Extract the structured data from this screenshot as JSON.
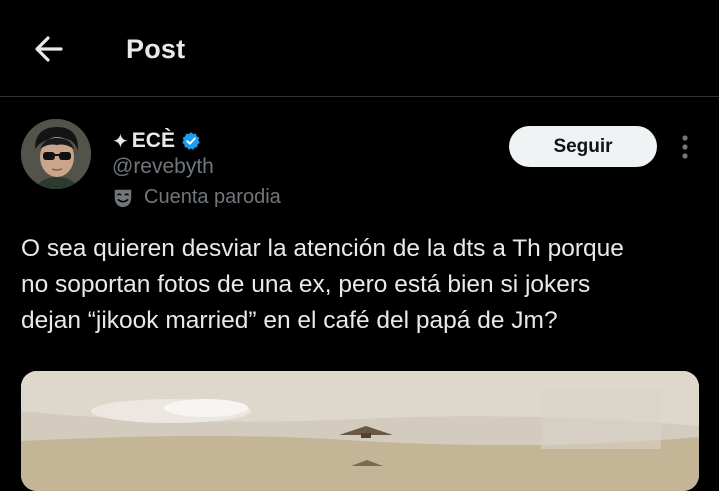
{
  "header": {
    "title": "Post",
    "back_icon": "arrow-left-icon"
  },
  "author": {
    "avatar_icon": "avatar-photo",
    "display_name": "ECÈ",
    "name_prefix_symbol": "✦",
    "verified": true,
    "verified_color": "#1d9bf0",
    "handle": "@revebyth",
    "parody_label": "Cuenta parodia",
    "parody_icon": "theater-mask-icon"
  },
  "actions": {
    "follow_label": "Seguir",
    "more_icon": "more-vertical-icon"
  },
  "post": {
    "text": "O sea quieren desviar la atención de la dts a Th porque\nno soportan fotos de una ex, pero está bien si jokers\ndejan “jikook married” en el café del papá de Jm?"
  },
  "colors": {
    "background": "#000000",
    "text_primary": "#e7e9ea",
    "text_secondary": "#71767b",
    "divider": "#2f3336",
    "follow_bg": "#eff3f4",
    "follow_text": "#0f1419"
  }
}
